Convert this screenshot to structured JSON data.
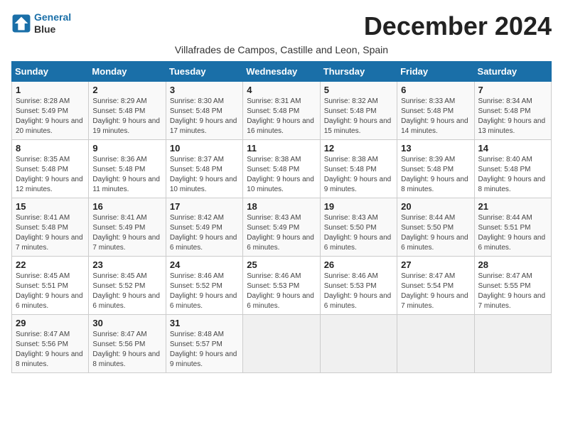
{
  "logo": {
    "line1": "General",
    "line2": "Blue"
  },
  "title": "December 2024",
  "subtitle": "Villafrades de Campos, Castille and Leon, Spain",
  "days_of_week": [
    "Sunday",
    "Monday",
    "Tuesday",
    "Wednesday",
    "Thursday",
    "Friday",
    "Saturday"
  ],
  "weeks": [
    [
      {
        "day": 1,
        "sunrise": "8:28 AM",
        "sunset": "5:49 PM",
        "daylight": "9 hours and 20 minutes."
      },
      {
        "day": 2,
        "sunrise": "8:29 AM",
        "sunset": "5:48 PM",
        "daylight": "9 hours and 19 minutes."
      },
      {
        "day": 3,
        "sunrise": "8:30 AM",
        "sunset": "5:48 PM",
        "daylight": "9 hours and 17 minutes."
      },
      {
        "day": 4,
        "sunrise": "8:31 AM",
        "sunset": "5:48 PM",
        "daylight": "9 hours and 16 minutes."
      },
      {
        "day": 5,
        "sunrise": "8:32 AM",
        "sunset": "5:48 PM",
        "daylight": "9 hours and 15 minutes."
      },
      {
        "day": 6,
        "sunrise": "8:33 AM",
        "sunset": "5:48 PM",
        "daylight": "9 hours and 14 minutes."
      },
      {
        "day": 7,
        "sunrise": "8:34 AM",
        "sunset": "5:48 PM",
        "daylight": "9 hours and 13 minutes."
      }
    ],
    [
      {
        "day": 8,
        "sunrise": "8:35 AM",
        "sunset": "5:48 PM",
        "daylight": "9 hours and 12 minutes."
      },
      {
        "day": 9,
        "sunrise": "8:36 AM",
        "sunset": "5:48 PM",
        "daylight": "9 hours and 11 minutes."
      },
      {
        "day": 10,
        "sunrise": "8:37 AM",
        "sunset": "5:48 PM",
        "daylight": "9 hours and 10 minutes."
      },
      {
        "day": 11,
        "sunrise": "8:38 AM",
        "sunset": "5:48 PM",
        "daylight": "9 hours and 10 minutes."
      },
      {
        "day": 12,
        "sunrise": "8:38 AM",
        "sunset": "5:48 PM",
        "daylight": "9 hours and 9 minutes."
      },
      {
        "day": 13,
        "sunrise": "8:39 AM",
        "sunset": "5:48 PM",
        "daylight": "9 hours and 8 minutes."
      },
      {
        "day": 14,
        "sunrise": "8:40 AM",
        "sunset": "5:48 PM",
        "daylight": "9 hours and 8 minutes."
      }
    ],
    [
      {
        "day": 15,
        "sunrise": "8:41 AM",
        "sunset": "5:48 PM",
        "daylight": "9 hours and 7 minutes."
      },
      {
        "day": 16,
        "sunrise": "8:41 AM",
        "sunset": "5:49 PM",
        "daylight": "9 hours and 7 minutes."
      },
      {
        "day": 17,
        "sunrise": "8:42 AM",
        "sunset": "5:49 PM",
        "daylight": "9 hours and 6 minutes."
      },
      {
        "day": 18,
        "sunrise": "8:43 AM",
        "sunset": "5:49 PM",
        "daylight": "9 hours and 6 minutes."
      },
      {
        "day": 19,
        "sunrise": "8:43 AM",
        "sunset": "5:50 PM",
        "daylight": "9 hours and 6 minutes."
      },
      {
        "day": 20,
        "sunrise": "8:44 AM",
        "sunset": "5:50 PM",
        "daylight": "9 hours and 6 minutes."
      },
      {
        "day": 21,
        "sunrise": "8:44 AM",
        "sunset": "5:51 PM",
        "daylight": "9 hours and 6 minutes."
      }
    ],
    [
      {
        "day": 22,
        "sunrise": "8:45 AM",
        "sunset": "5:51 PM",
        "daylight": "9 hours and 6 minutes."
      },
      {
        "day": 23,
        "sunrise": "8:45 AM",
        "sunset": "5:52 PM",
        "daylight": "9 hours and 6 minutes."
      },
      {
        "day": 24,
        "sunrise": "8:46 AM",
        "sunset": "5:52 PM",
        "daylight": "9 hours and 6 minutes."
      },
      {
        "day": 25,
        "sunrise": "8:46 AM",
        "sunset": "5:53 PM",
        "daylight": "9 hours and 6 minutes."
      },
      {
        "day": 26,
        "sunrise": "8:46 AM",
        "sunset": "5:53 PM",
        "daylight": "9 hours and 6 minutes."
      },
      {
        "day": 27,
        "sunrise": "8:47 AM",
        "sunset": "5:54 PM",
        "daylight": "9 hours and 7 minutes."
      },
      {
        "day": 28,
        "sunrise": "8:47 AM",
        "sunset": "5:55 PM",
        "daylight": "9 hours and 7 minutes."
      }
    ],
    [
      {
        "day": 29,
        "sunrise": "8:47 AM",
        "sunset": "5:56 PM",
        "daylight": "9 hours and 8 minutes."
      },
      {
        "day": 30,
        "sunrise": "8:47 AM",
        "sunset": "5:56 PM",
        "daylight": "9 hours and 8 minutes."
      },
      {
        "day": 31,
        "sunrise": "8:48 AM",
        "sunset": "5:57 PM",
        "daylight": "9 hours and 9 minutes."
      },
      null,
      null,
      null,
      null
    ]
  ]
}
